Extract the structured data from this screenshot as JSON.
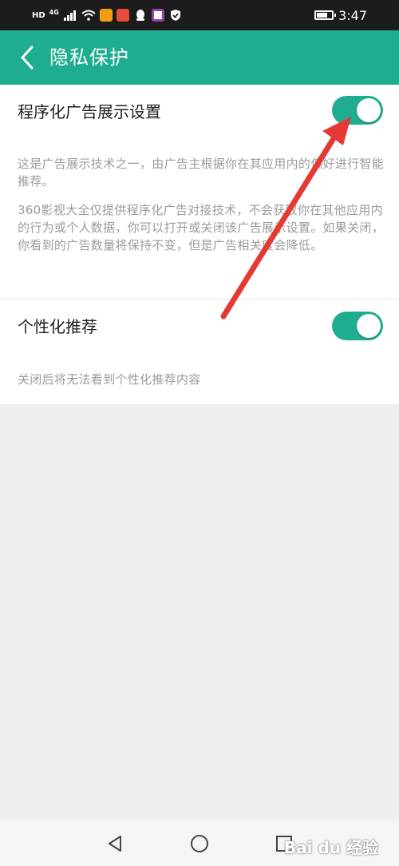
{
  "status_bar": {
    "network_label": "HD",
    "signal_type": "4G",
    "time": "3:47",
    "battery_fraction": 0.7,
    "icons": [
      "hd-icon",
      "signal-icon",
      "wifi-icon",
      "app-icon-1",
      "app-icon-2",
      "qq-icon",
      "message-app-icon",
      "shield-icon"
    ]
  },
  "header": {
    "title": "隐私保护",
    "background": "#1fad8f"
  },
  "settings": {
    "programmatic_ads": {
      "title": "程序化广告展示设置",
      "enabled": true,
      "desc_1": "这是广告展示技术之一，由广告主根据你在其应用内的偏好进行智能推荐。",
      "desc_2": "360影视大全仅提供程序化广告对接技术，不会获取你在其他应用内的行为或个人数据，你可以打开或关闭该广告展示设置。如果关闭，你看到的广告数量将保持不变，但是广告相关度会降低。"
    },
    "personalized": {
      "title": "个性化推荐",
      "enabled": true,
      "desc": "关闭后将无法看到个性化推荐内容"
    }
  },
  "colors": {
    "accent": "#1fad8f",
    "annotation_arrow": "#e53935"
  },
  "nav": {
    "buttons": [
      "back-triangle-icon",
      "home-circle-icon",
      "recent-square-icon"
    ]
  },
  "watermark": "Bai du 经验"
}
